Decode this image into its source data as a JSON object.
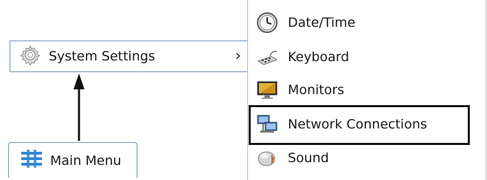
{
  "menu": {
    "system_settings_label": "System Settings",
    "system_settings_icon": "gear-icon",
    "main_menu_label": "Main Menu",
    "main_menu_icon": "main-menu-icon"
  },
  "submenu": {
    "items": [
      {
        "label": "Date/Time",
        "icon": "clock-icon"
      },
      {
        "label": "Keyboard",
        "icon": "keyboard-icon"
      },
      {
        "label": "Monitors",
        "icon": "monitor-icon"
      },
      {
        "label": "Network Connections",
        "icon": "network-icon"
      },
      {
        "label": "Sound",
        "icon": "speaker-icon"
      }
    ]
  },
  "highlighted_item": "Network Connections",
  "colors": {
    "menu_border": "#6a8fb8",
    "highlight_border": "#111111",
    "arrow": "#111111"
  }
}
